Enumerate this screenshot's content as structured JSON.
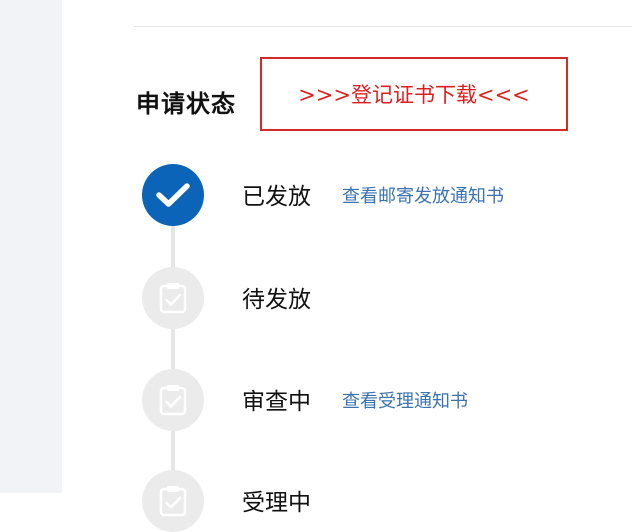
{
  "section": {
    "title": "申请状态",
    "download_label": ">>>登记证书下载<<<"
  },
  "steps": [
    {
      "label": "已发放",
      "link": "查看邮寄发放通知书",
      "state": "done"
    },
    {
      "label": "待发放",
      "link": "",
      "state": "pending"
    },
    {
      "label": "审查中",
      "link": "查看受理通知书",
      "state": "pending"
    },
    {
      "label": "受理中",
      "link": "",
      "state": "pending"
    }
  ],
  "colors": {
    "done": "#0c64b9",
    "pending": "#ebebeb",
    "download_border": "#d42a2a",
    "download_text": "#dd1f1f",
    "link": "#3a73b0"
  },
  "icons": {
    "done": "check-icon",
    "pending": "clipboard-check-icon"
  }
}
